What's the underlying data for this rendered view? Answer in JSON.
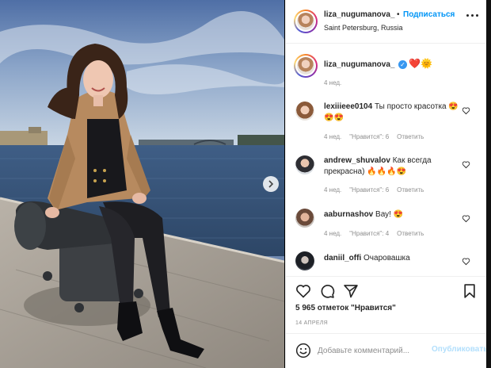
{
  "header": {
    "username": "liza_nugumanova_",
    "separator": "•",
    "follow_label": "Подписаться",
    "location": "Saint Petersburg, Russia"
  },
  "caption": {
    "username": "liza_nugumanova_",
    "verified_mark": "✓",
    "emoji": "❤️🌞",
    "time": "4 нед."
  },
  "comments": [
    {
      "username": "lexiiieee0104",
      "text": "Ты просто красотка 😍😍😍",
      "time": "4 нед.",
      "likes": "\"Нравится\": 6",
      "reply": "Ответить"
    },
    {
      "username": "andrew_shuvalov",
      "text": "Как всегда прекрасна) 🔥🔥🔥😍",
      "time": "4 нед.",
      "likes": "\"Нравится\": 6",
      "reply": "Ответить"
    },
    {
      "username": "aaburnashov",
      "text": "Вау! 😍",
      "time": "4 нед.",
      "likes": "\"Нравится\": 4",
      "reply": "Ответить"
    },
    {
      "username": "daniil_offi",
      "text": "Очаровашка",
      "time": "",
      "likes": "",
      "reply": ""
    }
  ],
  "actions": {
    "likes_text": "5 965 отметок \"Нравится\"",
    "date": "14 АПРЕЛЯ"
  },
  "add_comment": {
    "placeholder": "Добавьте комментарий...",
    "post_label": "Опубликовать"
  },
  "icons": {
    "more": "more-options-icon",
    "like": "heart-icon",
    "comment": "comment-icon",
    "share": "paper-plane-icon",
    "save": "bookmark-icon",
    "emoji": "smiley-icon",
    "next": "chevron-right-icon"
  },
  "colors": {
    "accent": "#0095f6",
    "post_disabled": "#b2dffc",
    "muted": "#8e8e8e",
    "text": "#262626"
  }
}
